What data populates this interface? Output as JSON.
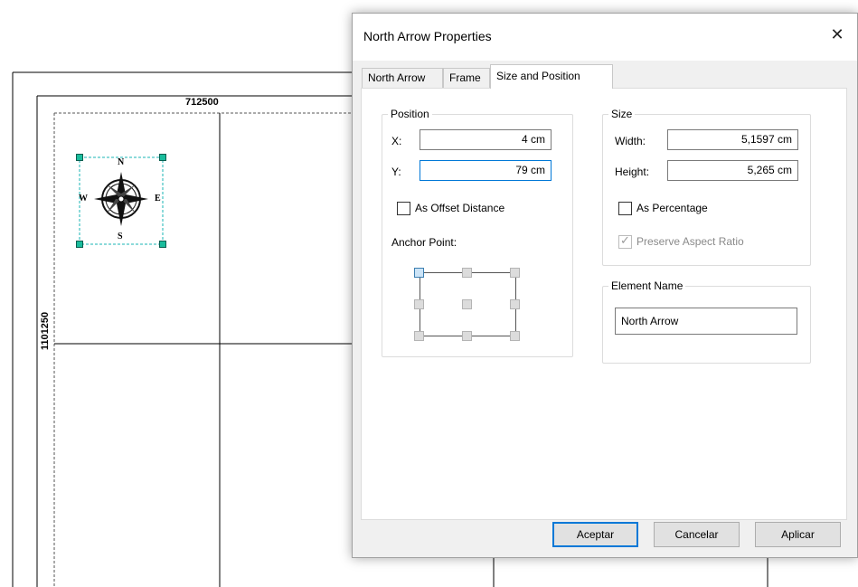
{
  "layout": {
    "coord_top": "712500",
    "coord_side": "1101250",
    "north_arrow": {
      "n": "N",
      "s": "S",
      "e": "E",
      "w": "W"
    }
  },
  "dialog": {
    "title": "North Arrow Properties",
    "close_glyph": "✕",
    "tabs": [
      {
        "label": "North Arrow"
      },
      {
        "label": "Frame"
      },
      {
        "label": "Size and Position",
        "active": true
      }
    ],
    "position": {
      "legend": "Position",
      "x_label": "X:",
      "x_value": "4 cm",
      "y_label": "Y:",
      "y_value": "79 cm",
      "offset_label": "As Offset Distance",
      "offset_checked": false,
      "anchor_label": "Anchor Point:",
      "anchor_selected": "top-left"
    },
    "size": {
      "legend": "Size",
      "width_label": "Width:",
      "width_value": "5,1597 cm",
      "height_label": "Height:",
      "height_value": "5,265 cm",
      "percentage_label": "As Percentage",
      "percentage_checked": false,
      "aspect_label": "Preserve Aspect Ratio",
      "aspect_checked": true
    },
    "element_name": {
      "legend": "Element Name",
      "value": "North Arrow"
    },
    "buttons": {
      "ok": "Aceptar",
      "cancel": "Cancelar",
      "apply": "Aplicar"
    }
  }
}
